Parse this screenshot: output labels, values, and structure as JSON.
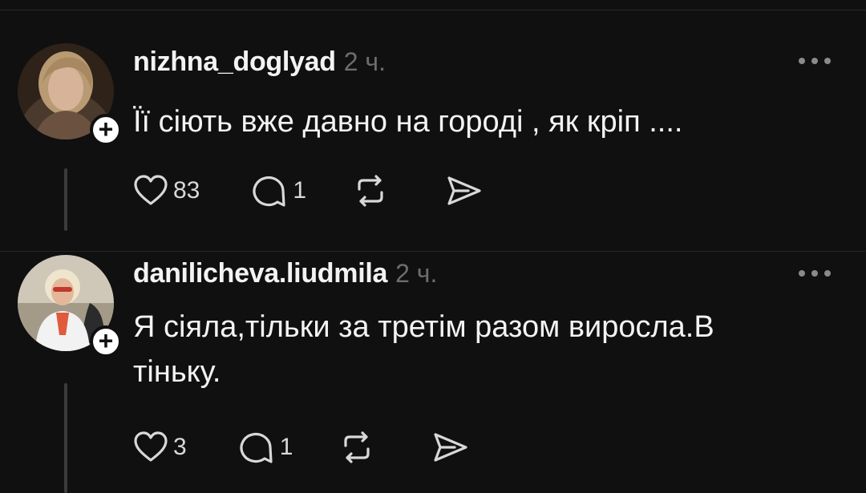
{
  "posts": [
    {
      "username": "nizhna_doglyad",
      "time": "2 ч.",
      "text": "Її сіють вже давно на городі , як кріп ....",
      "likes": "83",
      "replies": "1",
      "avatar_colors": {
        "bg": "#3a2b21",
        "hair": "#b89a73",
        "skin": "#d7b39a"
      }
    },
    {
      "username": "danilicheva.liudmila",
      "time": "2 ч.",
      "text": "Я сіяла,тільки за третім разом виросла.В тіньку.",
      "likes": "3",
      "replies": "1",
      "avatar_colors": {
        "bg": "#c9c0b1",
        "hair": "#e8dcc2",
        "skin": "#e4b79b"
      }
    }
  ],
  "icons": {
    "more": "more-icon",
    "like": "heart-icon",
    "reply": "comment-icon",
    "repost": "repost-icon",
    "share": "send-icon",
    "follow": "plus-icon"
  },
  "colors": {
    "background": "#101010",
    "text": "#f3f3f3",
    "muted": "#6d6d6d"
  }
}
